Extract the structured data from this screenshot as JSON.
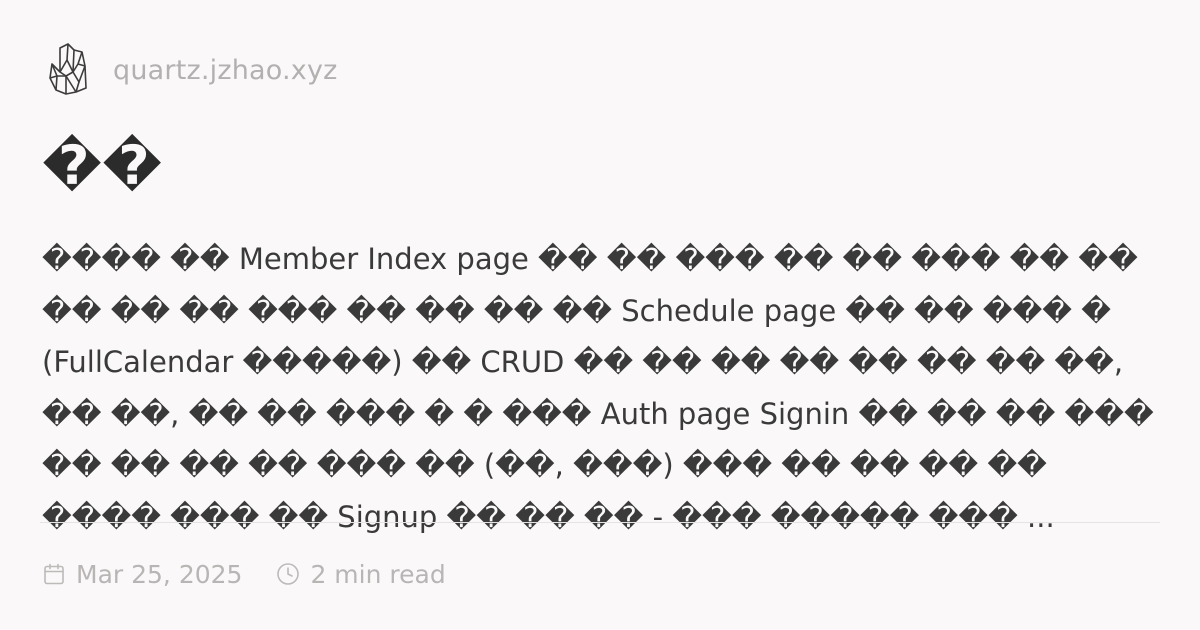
{
  "site": {
    "logo_icon": "quartz-crystal-icon",
    "url": "quartz.jzhao.xyz"
  },
  "page": {
    "title": "��",
    "description": "���� �� Member Index page �� �� ��� �� �� ��� �� �� �� �� �� ��� �� �� �� �� Schedule page �� �� ��� � (FullCalendar �����) �� CRUD �� �� �� �� �� �� �� ��, �� ��, �� �� ��� � � ��� Auth page Signin �� �� �� ��� �� �� �� �� ��� �� (��, ���) ��� �� �� �� �� ���� ��� �� Signup �� �� �� - ��� ����� ��� ..."
  },
  "meta": {
    "date_icon": "calendar-icon",
    "date": "Mar 25, 2025",
    "reading_time_icon": "clock-icon",
    "reading_time": "2 min read"
  },
  "colors": {
    "background": "#faf8f8",
    "text": "#2b2b2b",
    "muted": "#b8b5b5",
    "divider": "#e6e3e3"
  }
}
